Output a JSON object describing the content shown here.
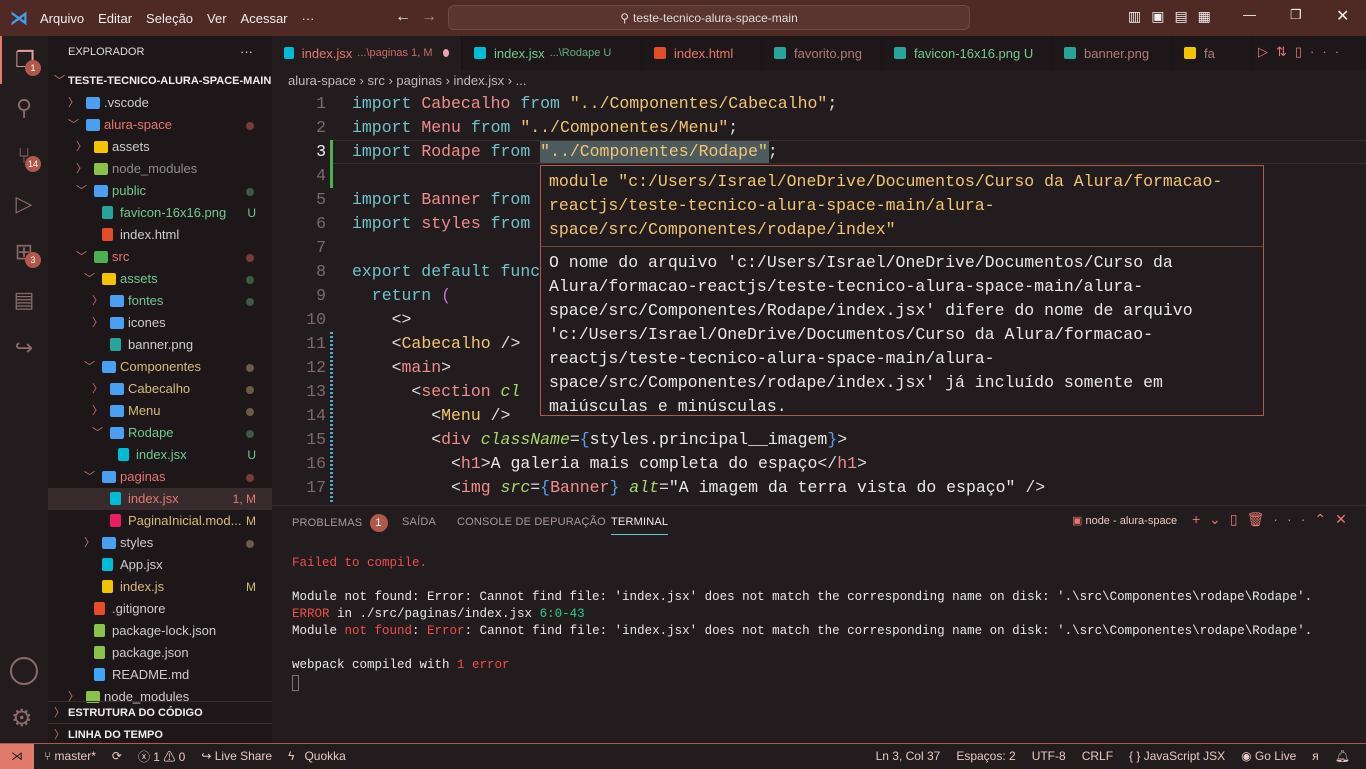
{
  "titlebar": {
    "menus": [
      "Arquivo",
      "Editar",
      "Seleção",
      "Ver",
      "Acessar",
      "···"
    ],
    "search": "teste-tecnico-alura-space-main"
  },
  "activity": [
    {
      "icon": "files-icon",
      "badge": "1"
    },
    {
      "icon": "search-icon",
      "badge": ""
    },
    {
      "icon": "source-control-icon",
      "badge": "14"
    },
    {
      "icon": "run-debug-icon",
      "badge": ""
    },
    {
      "icon": "extensions-icon",
      "badge": "3"
    },
    {
      "icon": "notebook-icon",
      "badge": ""
    },
    {
      "icon": "live-share-icon",
      "badge": ""
    }
  ],
  "sidebar": {
    "title": "EXPLORADOR",
    "more": "···",
    "root": "TESTE-TECNICO-ALURA-SPACE-MAIN",
    "items": [
      {
        "label": ".vscode",
        "depth": 0,
        "kind": "folder",
        "open": false,
        "color": "#cccccc",
        "icon": "#4a9ff0",
        "badge": "",
        "dot": ""
      },
      {
        "label": "alura-space",
        "depth": 0,
        "kind": "folder",
        "open": true,
        "color": "#e5786d",
        "icon": "#4a9ff0",
        "badge": "",
        "dot": "#7a3b36"
      },
      {
        "label": "assets",
        "depth": 1,
        "kind": "folder",
        "open": false,
        "color": "#cccccc",
        "icon": "#f5c400",
        "badge": "",
        "dot": ""
      },
      {
        "label": "node_modules",
        "depth": 1,
        "kind": "folder",
        "open": false,
        "color": "#8c8c8c",
        "icon": "#8bc34a",
        "badge": "",
        "dot": ""
      },
      {
        "label": "public",
        "depth": 1,
        "kind": "folder",
        "open": true,
        "color": "#73c991",
        "icon": "#4a9ff0",
        "badge": "",
        "dot": "#3d5a44"
      },
      {
        "label": "favicon-16x16.png",
        "depth": 2,
        "kind": "file",
        "color": "#73c991",
        "icon": "#26a69a",
        "badge": "U",
        "badgeColor": "#73c991",
        "dot": ""
      },
      {
        "label": "index.html",
        "depth": 2,
        "kind": "file",
        "color": "#cccccc",
        "icon": "#e44d26",
        "badge": "",
        "dot": ""
      },
      {
        "label": "src",
        "depth": 1,
        "kind": "folder",
        "open": true,
        "color": "#e5786d",
        "icon": "#4caf50",
        "badge": "",
        "dot": "#7a3b36"
      },
      {
        "label": "assets",
        "depth": 2,
        "kind": "folder",
        "open": true,
        "color": "#73c991",
        "icon": "#f5c400",
        "badge": "",
        "dot": "#3d5a44"
      },
      {
        "label": "fontes",
        "depth": 3,
        "kind": "folder",
        "open": false,
        "color": "#73c991",
        "icon": "#4a9ff0",
        "badge": "",
        "dot": "#3d5a44"
      },
      {
        "label": "icones",
        "depth": 3,
        "kind": "folder",
        "open": false,
        "color": "#cccccc",
        "icon": "#4a9ff0",
        "badge": "",
        "dot": ""
      },
      {
        "label": "banner.png",
        "depth": 3,
        "kind": "file",
        "color": "#cccccc",
        "icon": "#26a69a",
        "badge": "",
        "dot": ""
      },
      {
        "label": "Componentes",
        "depth": 2,
        "kind": "folder",
        "open": true,
        "color": "#d7ba7d",
        "icon": "#4a9ff0",
        "badge": "",
        "dot": "#6b5a44"
      },
      {
        "label": "Cabecalho",
        "depth": 3,
        "kind": "folder",
        "open": false,
        "color": "#d7ba7d",
        "icon": "#4a9ff0",
        "badge": "",
        "dot": "#6b5a44"
      },
      {
        "label": "Menu",
        "depth": 3,
        "kind": "folder",
        "open": false,
        "color": "#d7ba7d",
        "icon": "#4a9ff0",
        "badge": "",
        "dot": "#6b5a44"
      },
      {
        "label": "Rodape",
        "depth": 3,
        "kind": "folder",
        "open": true,
        "color": "#73c991",
        "icon": "#4a9ff0",
        "badge": "",
        "dot": "#3d5a44"
      },
      {
        "label": "index.jsx",
        "depth": 4,
        "kind": "file",
        "color": "#73c991",
        "icon": "#00bcd4",
        "badge": "U",
        "badgeColor": "#73c991",
        "dot": ""
      },
      {
        "label": "paginas",
        "depth": 2,
        "kind": "folder",
        "open": true,
        "color": "#e5786d",
        "icon": "#4a9ff0",
        "badge": "",
        "dot": "#7a3b36"
      },
      {
        "label": "index.jsx",
        "depth": 3,
        "kind": "file",
        "color": "#e5786d",
        "icon": "#00bcd4",
        "badge": "1, M",
        "badgeColor": "#e5786d",
        "dot": "",
        "selected": true
      },
      {
        "label": "PaginaInicial.mod...",
        "depth": 3,
        "kind": "file",
        "color": "#d7ba7d",
        "icon": "#e91e63",
        "badge": "M",
        "badgeColor": "#d7ba7d",
        "dot": ""
      },
      {
        "label": "styles",
        "depth": 2,
        "kind": "folder",
        "open": false,
        "color": "#cccccc",
        "icon": "#4a9ff0",
        "badge": "",
        "dot": "#6b5a44"
      },
      {
        "label": "App.jsx",
        "depth": 2,
        "kind": "file",
        "color": "#cccccc",
        "icon": "#00bcd4",
        "badge": "",
        "dot": ""
      },
      {
        "label": "index.js",
        "depth": 2,
        "kind": "file",
        "color": "#d7ba7d",
        "icon": "#f5c400",
        "badge": "M",
        "badgeColor": "#d7ba7d",
        "dot": ""
      },
      {
        "label": ".gitignore",
        "depth": 1,
        "kind": "file",
        "color": "#cccccc",
        "icon": "#e44d26",
        "badge": "",
        "dot": ""
      },
      {
        "label": "package-lock.json",
        "depth": 1,
        "kind": "file",
        "color": "#cccccc",
        "icon": "#8bc34a",
        "badge": "",
        "dot": ""
      },
      {
        "label": "package.json",
        "depth": 1,
        "kind": "file",
        "color": "#cccccc",
        "icon": "#8bc34a",
        "badge": "",
        "dot": ""
      },
      {
        "label": "README.md",
        "depth": 1,
        "kind": "file",
        "color": "#cccccc",
        "icon": "#42a5f5",
        "badge": "",
        "dot": ""
      },
      {
        "label": "node_modules",
        "depth": 0,
        "kind": "folder",
        "open": false,
        "color": "#cccccc",
        "icon": "#8bc34a",
        "badge": "",
        "dot": ""
      }
    ],
    "sections": [
      "ESTRUTURA DO CÓDIGO",
      "LINHA DO TEMPO"
    ]
  },
  "tabs": [
    {
      "label": "index.jsx",
      "desc": "...\\paginas 1, M",
      "color": "#e5786d",
      "icon": "#00bcd4",
      "active": true,
      "dirty": true
    },
    {
      "label": "index.jsx",
      "desc": "...\\Rodape U",
      "color": "#73c991",
      "icon": "#00bcd4"
    },
    {
      "label": "index.html",
      "desc": "",
      "color": "#e5786d",
      "icon": "#e44d26"
    },
    {
      "label": "favorito.png",
      "desc": "",
      "color": "#b07a7a",
      "icon": "#26a69a"
    },
    {
      "label": "favicon-16x16.png U",
      "desc": "",
      "color": "#73c991",
      "icon": "#26a69a"
    },
    {
      "label": "banner.png",
      "desc": "",
      "color": "#b07a7a",
      "icon": "#26a69a"
    },
    {
      "label": "fa",
      "desc": "",
      "color": "#b07a7a",
      "icon": "#f5c400"
    }
  ],
  "breadcrumb": [
    "alura-space",
    "src",
    "paginas",
    "index.jsx",
    "..."
  ],
  "code": [
    [
      [
        "import ",
        "kw"
      ],
      [
        "Cabecalho ",
        "id"
      ],
      [
        "from ",
        "kw"
      ],
      [
        "\"../Componentes/Cabecalho\"",
        "st"
      ],
      [
        ";",
        "pu"
      ]
    ],
    [
      [
        "import ",
        "kw"
      ],
      [
        "Menu ",
        "id"
      ],
      [
        "from ",
        "kw"
      ],
      [
        "\"../Componentes/Menu\"",
        "st"
      ],
      [
        ";",
        "pu"
      ]
    ],
    [
      [
        "import ",
        "kw"
      ],
      [
        "Rodape ",
        "id"
      ],
      [
        "from ",
        "kw"
      ],
      [
        "\"../Componentes/Rodape\"",
        "st"
      ],
      [
        ";",
        "pu"
      ]
    ],
    [],
    [
      [
        "import ",
        "kw"
      ],
      [
        "Banner ",
        "id"
      ],
      [
        "from",
        "kw"
      ]
    ],
    [
      [
        "import ",
        "kw"
      ],
      [
        "styles ",
        "id"
      ],
      [
        "from",
        "kw"
      ]
    ],
    [],
    [
      [
        "export default func",
        "kw"
      ]
    ],
    [
      [
        "  return ",
        "kw"
      ],
      [
        "(",
        "pp"
      ]
    ],
    [
      [
        "    <>",
        "pu"
      ]
    ],
    [
      [
        "    <",
        "pu"
      ],
      [
        "Cabecalho",
        "cm"
      ],
      [
        " />",
        "pu"
      ]
    ],
    [
      [
        "    <",
        "pu"
      ],
      [
        "main",
        "tg"
      ],
      [
        ">",
        "pu"
      ]
    ],
    [
      [
        "      <",
        "pu"
      ],
      [
        "section ",
        "tg"
      ],
      [
        "cl",
        "at"
      ]
    ],
    [
      [
        "        <",
        "pu"
      ],
      [
        "Menu",
        "cm"
      ],
      [
        " />",
        "pu"
      ]
    ],
    [
      [
        "        <",
        "pu"
      ],
      [
        "div ",
        "tg"
      ],
      [
        "className",
        "at"
      ],
      [
        "=",
        "pu"
      ],
      [
        "{",
        "br"
      ],
      [
        "styles.principal__imagem",
        "tx"
      ],
      [
        "}",
        "br"
      ],
      [
        ">",
        "pu"
      ]
    ],
    [
      [
        "          <",
        "pu"
      ],
      [
        "h1",
        "tg"
      ],
      [
        ">",
        "pu"
      ],
      [
        "A galeria mais completa do espaço",
        "tx"
      ],
      [
        "</",
        "pu"
      ],
      [
        "h1",
        "tg"
      ],
      [
        ">",
        "pu"
      ]
    ],
    [
      [
        "          <",
        "pu"
      ],
      [
        "img ",
        "tg"
      ],
      [
        "src",
        "at"
      ],
      [
        "=",
        "pu"
      ],
      [
        "{",
        "br"
      ],
      [
        "Banner",
        "id"
      ],
      [
        "}",
        "br"
      ],
      [
        " alt",
        "at"
      ],
      [
        "=",
        "pu"
      ],
      [
        "\"A imagem da terra vista do espaço\"",
        "tx"
      ],
      [
        " />",
        "pu"
      ]
    ]
  ],
  "hover": {
    "module": "module \"c:/Users/Israel/OneDrive/Documentos/Curso da Alura/formacao-reactjs/teste-tecnico-alura-space-main/alura-space/src/Componentes/rodape/index\"",
    "message": "O nome do arquivo 'c:/Users/Israel/OneDrive/Documentos/Curso da Alura/formacao-reactjs/teste-tecnico-alura-space-main/alura-space/src/Componentes/Rodape/index.jsx' difere do nome de arquivo 'c:/Users/Israel/OneDrive/Documentos/Curso da Alura/formacao-reactjs/teste-tecnico-alura-space-main/alura-space/src/Componentes/rodape/index.jsx' já incluído somente em maiúsculas e minúsculas."
  },
  "panel": {
    "tabs": [
      "PROBLEMAS",
      "SAÍDA",
      "CONSOLE DE DEPURAÇÃO",
      "TERMINAL"
    ],
    "problems_count": "1",
    "terminal_name": "node - alura-space",
    "lines": [
      [
        [
          "Failed to compile.",
          "red"
        ]
      ],
      [],
      [
        [
          "Module not found: Error: Cannot find file: 'index.jsx' does not match the corresponding name on disk: '.\\src\\Componentes\\rodape\\Rodape'.",
          ""
        ]
      ],
      [
        [
          "ERROR",
          "red"
        ],
        [
          " in ./src/paginas/index.jsx ",
          ""
        ],
        [
          "6:0-43",
          "grn"
        ]
      ],
      [
        [
          "Module ",
          ""
        ],
        [
          "not found",
          "red"
        ],
        [
          ": ",
          ""
        ],
        [
          "Error",
          "red"
        ],
        [
          ": Cannot find file: 'index.jsx' does not match the corresponding name on disk: '.\\src\\Componentes\\rodape\\Rodape'.",
          ""
        ]
      ],
      [],
      [
        [
          "webpack compiled with ",
          ""
        ],
        [
          "1 error",
          "red"
        ]
      ]
    ]
  },
  "status": {
    "branch": "master*",
    "errors": "1",
    "warnings": "0",
    "liveshare": "Live Share",
    "quokka": "Quokka",
    "position": "Ln 3, Col 37",
    "spaces": "Espaços: 2",
    "encoding": "UTF-8",
    "eol": "CRLF",
    "language": "JavaScript JSX",
    "golive": "Go Live"
  },
  "colors": {
    "titlebar": "#4f2a25",
    "editor_bg": "#231c1f",
    "accent": "#b0584a"
  }
}
